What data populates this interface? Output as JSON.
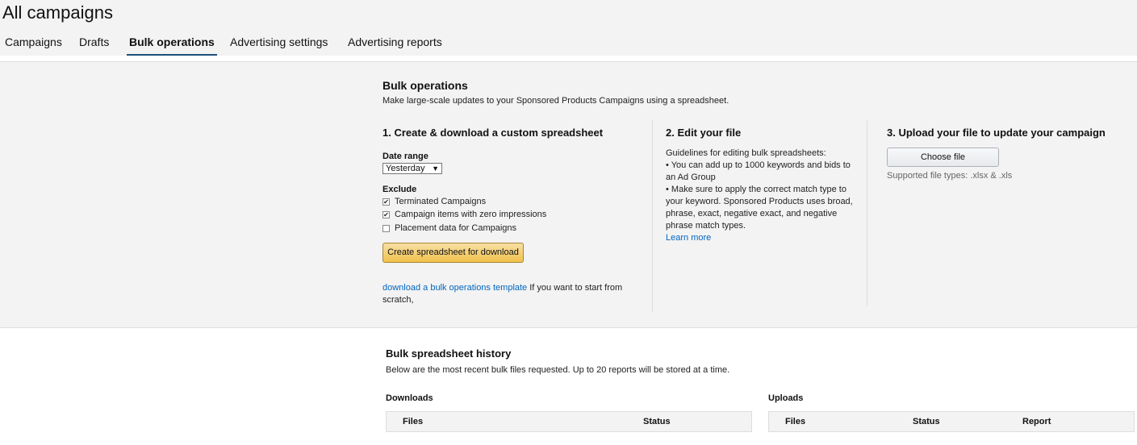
{
  "page_title": "All campaigns",
  "tabs": [
    {
      "label": "Campaigns"
    },
    {
      "label": "Drafts"
    },
    {
      "label": "Bulk operations"
    },
    {
      "label": "Advertising settings"
    },
    {
      "label": "Advertising reports"
    }
  ],
  "bulk": {
    "title": "Bulk operations",
    "subtitle": "Make large-scale updates to your Sponsored Products Campaigns using a spreadsheet.",
    "step1": {
      "title": "1. Create & download a custom spreadsheet",
      "date_range_label": "Date range",
      "date_range_value": "Yesterday",
      "exclude_label": "Exclude",
      "options": [
        {
          "label": "Terminated Campaigns",
          "checked": "✔"
        },
        {
          "label": "Campaign items with zero impressions",
          "checked": "✔"
        },
        {
          "label": "Placement data for Campaigns",
          "checked": ""
        }
      ],
      "create_button": "Create spreadsheet for download",
      "template_link": "download a bulk operations template",
      "template_text": " If you want to start from scratch,"
    },
    "step2": {
      "title": "2. Edit your file",
      "guidelines_title": "Guidelines for editing bulk spreadsheets:",
      "bullet1": "• You can add up to 1000 keywords and bids to an Ad Group",
      "bullet2": "• Make sure to apply the correct match type to your keyword. Sponsored Products uses broad, phrase, exact, negative exact, and negative phrase match types.",
      "learn_more": "Learn more"
    },
    "step3": {
      "title": "3. Upload your file to update your campaign",
      "choose_file": "Choose file",
      "supported": "Supported file types: .xlsx & .xls"
    }
  },
  "history": {
    "title": "Bulk spreadsheet history",
    "subtitle": "Below are the most recent bulk files requested. Up to 20 reports will be stored at a time.",
    "downloads": {
      "label": "Downloads",
      "col_files": "Files",
      "col_status": "Status"
    },
    "uploads": {
      "label": "Uploads",
      "col_files": "Files",
      "col_status": "Status",
      "col_report": "Report"
    }
  }
}
